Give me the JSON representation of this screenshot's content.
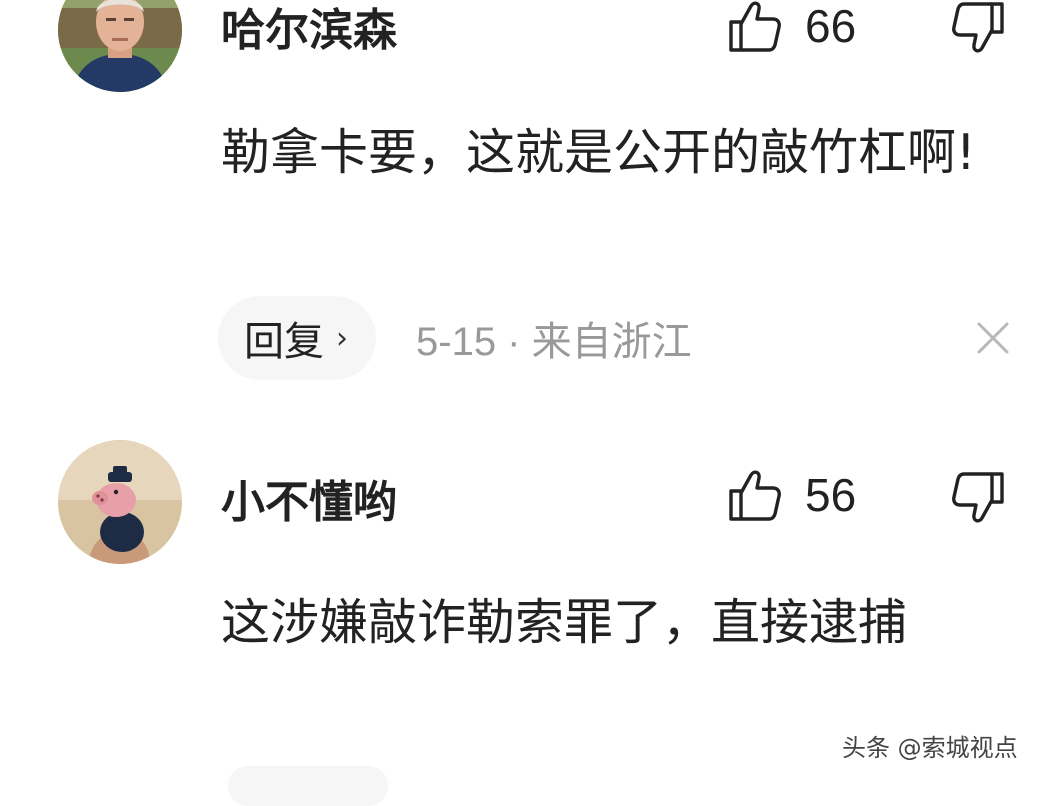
{
  "comments": [
    {
      "username": "哈尔滨森",
      "likes": "66",
      "content": "勒拿卡要，这就是公开的敲竹杠啊!",
      "reply_label": "回复",
      "reply_arrow": "›",
      "meta": "5-15 · 来自浙江",
      "avatar": "older-man-portrait"
    },
    {
      "username": "小不懂哟",
      "likes": "56",
      "content": "这涉嫌敲诈勒索罪了，直接逮捕",
      "avatar": "peppa-pig-toy"
    }
  ],
  "watermark": "头条 @索城视点",
  "icons": {
    "like": "thumbs-up-icon",
    "dislike": "thumbs-down-icon",
    "close": "close-icon"
  },
  "colors": {
    "text": "#222222",
    "meta": "#999999",
    "pill": "#f6f6f6"
  }
}
